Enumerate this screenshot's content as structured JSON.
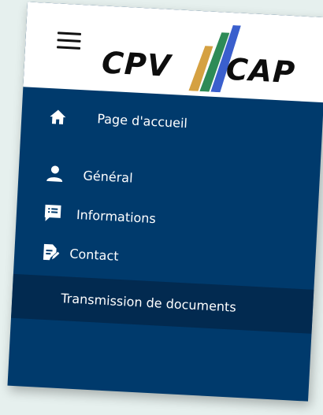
{
  "header": {
    "menu_toggle_icon": "hamburger-icon",
    "logo": {
      "left_text": "CPV",
      "right_text": "CAP",
      "stripe_colors": [
        "#d5a142",
        "#2e8b57",
        "#3a5fcd"
      ]
    }
  },
  "colors": {
    "sidebar_bg": "#003a6c",
    "active_item_bg": "#022a50",
    "text": "#ffffff"
  },
  "menu": {
    "items": [
      {
        "label": "Page d'accueil",
        "icon": "home-icon"
      },
      {
        "label": "Général",
        "icon": "user-icon"
      },
      {
        "label": "Informations",
        "icon": "list-message-icon"
      },
      {
        "label": "Contact",
        "icon": "document-edit-icon"
      },
      {
        "label": "Transmission de documents",
        "icon": ""
      }
    ]
  }
}
